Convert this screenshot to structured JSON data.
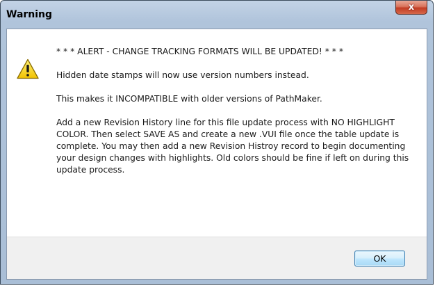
{
  "window": {
    "title": "Warning",
    "close_glyph": "x"
  },
  "message": {
    "icon": "warning-triangle-icon",
    "alert": "* * * ALERT - CHANGE TRACKING FORMATS WILL BE UPDATED! * * *",
    "line2": "Hidden date stamps will now use version numbers instead.",
    "line3": "This makes it INCOMPATIBLE with older versions of PathMaker.",
    "line4": "Add a new Revision History line for this file update process with NO HIGHLIGHT COLOR.  Then select SAVE AS and create a new .VUI file once the table update is complete.  You may then add a new Revision Histroy record to begin documenting your design changes with highlights.  Old colors should be fine if left on during this update process."
  },
  "buttons": {
    "ok_label": "OK"
  },
  "colors": {
    "accent": "#3c7fb1",
    "warning": "#f7d21c",
    "close": "#c23c24"
  }
}
